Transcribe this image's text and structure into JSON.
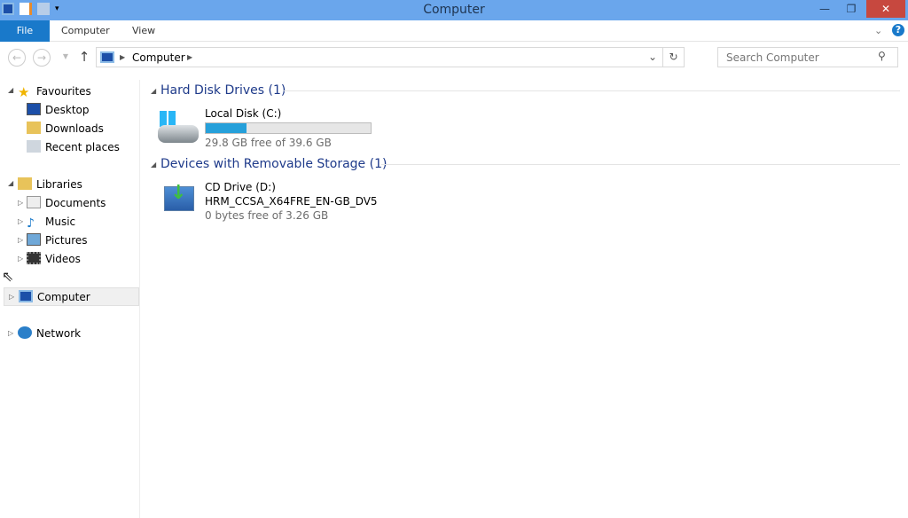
{
  "window": {
    "title": "Computer",
    "minimize": "—",
    "restore": "❐",
    "close": "✕"
  },
  "ribbon": {
    "tabs": [
      "File",
      "Computer",
      "View"
    ]
  },
  "address": {
    "path": "Computer",
    "search_placeholder": "Search Computer"
  },
  "sidebar": {
    "favourites": {
      "label": "Favourites",
      "items": [
        "Desktop",
        "Downloads",
        "Recent places"
      ]
    },
    "libraries": {
      "label": "Libraries",
      "items": [
        "Documents",
        "Music",
        "Pictures",
        "Videos"
      ]
    },
    "computer": "Computer",
    "network": "Network"
  },
  "groups": [
    {
      "title": "Hard Disk Drives (1)",
      "items": [
        {
          "name": "Local Disk (C:)",
          "free": "29.8 GB free of 39.6 GB",
          "used_fraction": 0.247
        }
      ]
    },
    {
      "title": "Devices with Removable Storage (1)",
      "items": [
        {
          "name": "CD Drive (D:)",
          "label": "HRM_CCSA_X64FRE_EN-GB_DV5",
          "free": "0 bytes free of 3.26 GB"
        }
      ]
    }
  ],
  "colors": {
    "titlebar": "#6aa6ec",
    "file_tab": "#1979ca",
    "progress": "#26a0da",
    "group_title": "#1e3a8a"
  }
}
